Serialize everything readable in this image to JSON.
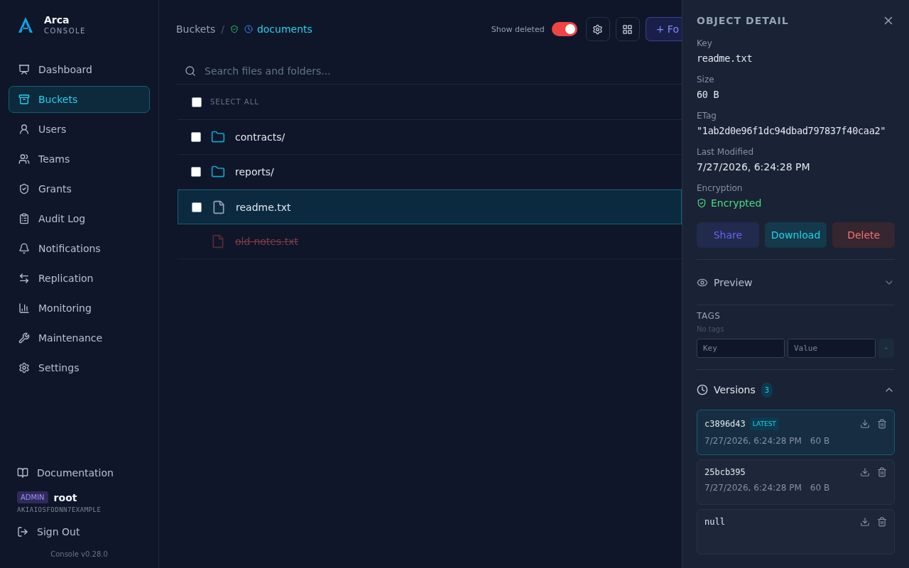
{
  "brand": {
    "name": "Arca",
    "subtitle": "CONSOLE"
  },
  "nav": [
    {
      "label": "Dashboard",
      "selected": false
    },
    {
      "label": "Buckets",
      "selected": true
    },
    {
      "label": "Users",
      "selected": false
    },
    {
      "label": "Teams",
      "selected": false
    },
    {
      "label": "Grants",
      "selected": false
    },
    {
      "label": "Audit Log",
      "selected": false
    },
    {
      "label": "Notifications",
      "selected": false
    },
    {
      "label": "Replication",
      "selected": false
    },
    {
      "label": "Monitoring",
      "selected": false
    },
    {
      "label": "Maintenance",
      "selected": false
    },
    {
      "label": "Settings",
      "selected": false
    }
  ],
  "footer": {
    "docs": "Documentation",
    "role": "ADMIN",
    "user": "root",
    "access_key": "AKIAIOSFODNN7EXAMPLE",
    "sign_out": "Sign Out",
    "version": "Console v0.28.0"
  },
  "breadcrumb": {
    "root": "Buckets",
    "separator": "/",
    "bucket": "documents"
  },
  "toolbar": {
    "show_deleted_label": "Show deleted",
    "show_deleted": true,
    "new_button": "+ Fo"
  },
  "search": {
    "placeholder": "Search files and folders..."
  },
  "select_all": {
    "label": "SELECT ALL",
    "checked": false
  },
  "files": [
    {
      "name": "contracts/",
      "kind": "folder",
      "checked": false,
      "selected": false,
      "deleted": false
    },
    {
      "name": "reports/",
      "kind": "folder",
      "checked": false,
      "selected": false,
      "deleted": false
    },
    {
      "name": "readme.txt",
      "kind": "file",
      "checked": false,
      "selected": true,
      "deleted": false
    },
    {
      "name": "old-notes.txt",
      "kind": "file",
      "selected": false,
      "deleted": true
    }
  ],
  "detail": {
    "title": "OBJECT DETAIL",
    "fields": [
      {
        "label": "Key",
        "value": "readme.txt",
        "kind": "mono"
      },
      {
        "label": "Size",
        "value": "60 B",
        "kind": "mono"
      },
      {
        "label": "ETag",
        "value": "\"1ab2d0e96f1dc94dbad797837f40caa2\"",
        "kind": "mono"
      },
      {
        "label": "Last Modified",
        "value": "7/27/2026, 6:24:28 PM",
        "kind": "text"
      },
      {
        "label": "Encryption",
        "value": "Encrypted",
        "kind": "status"
      }
    ],
    "actions": [
      {
        "label": "Share",
        "kind": "share"
      },
      {
        "label": "Download",
        "kind": "download"
      },
      {
        "label": "Delete",
        "kind": "delete"
      }
    ],
    "preview": {
      "label": "Preview",
      "expanded": false
    },
    "tags": {
      "title": "TAGS",
      "empty": "No tags",
      "key_placeholder": "Key",
      "value_placeholder": "Value",
      "add": "+"
    },
    "versions": {
      "label": "Versions",
      "count": "3",
      "expanded": true,
      "items": [
        {
          "id": "c3896d43",
          "badge": "LATEST",
          "date": "7/27/2026, 6:24:28 PM",
          "size": "60 B",
          "selected": true
        },
        {
          "id": "25bcb395",
          "date": "7/27/2026, 6:24:28 PM",
          "size": "60 B",
          "selected": false
        },
        {
          "id": "null",
          "selected": false
        }
      ]
    }
  }
}
